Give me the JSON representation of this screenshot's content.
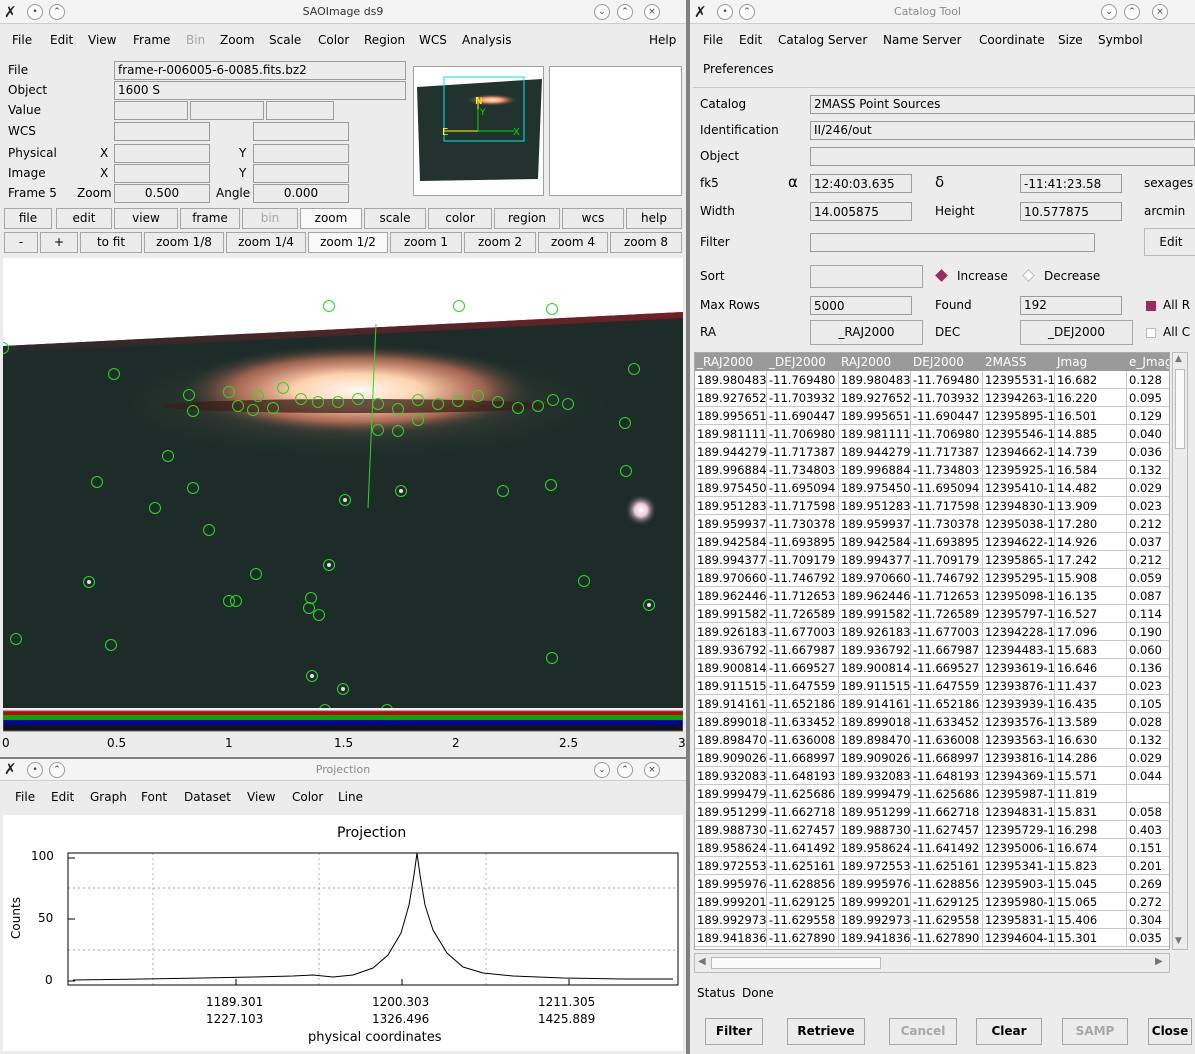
{
  "ds9": {
    "title": "SAOImage ds9",
    "menu": [
      "File",
      "Edit",
      "View",
      "Frame",
      "Bin",
      "Zoom",
      "Scale",
      "Color",
      "Region",
      "WCS",
      "Analysis"
    ],
    "help": "Help",
    "info": {
      "file_label": "File",
      "file_value": "frame-r-006005-6-0085.fits.bz2",
      "object_label": "Object",
      "object_value": "1600 S",
      "value_label": "Value",
      "wcs_label": "WCS",
      "physical_label": "Physical",
      "image_label": "Image",
      "x_label": "X",
      "y_label": "Y",
      "frame_label": "Frame 5",
      "zoom_label": "Zoom",
      "zoom_value": "0.500",
      "angle_label": "Angle",
      "angle_value": "0.000"
    },
    "panner_labels": {
      "n": "N",
      "e": "E",
      "x": "X",
      "y": "Y"
    },
    "buttonbar": [
      "file",
      "edit",
      "view",
      "frame",
      "bin",
      "zoom",
      "scale",
      "color",
      "region",
      "wcs",
      "help"
    ],
    "zoombar": [
      "-",
      "+",
      "to fit",
      "zoom 1/8",
      "zoom 1/4",
      "zoom 1/2",
      "zoom 1",
      "zoom 2",
      "zoom 4",
      "zoom 8"
    ],
    "colorbar_ticks": [
      "0",
      "0.5",
      "1",
      "1.5",
      "2",
      "2.5",
      "3"
    ]
  },
  "projection": {
    "title": "Projection",
    "menu": [
      "File",
      "Edit",
      "Graph",
      "Font",
      "Dataset",
      "View",
      "Color",
      "Line"
    ],
    "plot_title": "Projection",
    "ylabel": "Counts",
    "xlabel": "physical coordinates",
    "yticks": [
      "100",
      "50",
      "0"
    ],
    "xticks_top": [
      "1189.301",
      "1200.303",
      "1211.305"
    ],
    "xticks_bottom": [
      "1227.103",
      "1326.496",
      "1425.889"
    ]
  },
  "catalog": {
    "title": "Catalog Tool",
    "menu": [
      "File",
      "Edit",
      "Catalog Server",
      "Name Server",
      "Coordinate",
      "Size",
      "Symbol"
    ],
    "menu2": "Preferences",
    "catalog_label": "Catalog",
    "catalog_value": "2MASS Point Sources",
    "ident_label": "Identification",
    "ident_value": "II/246/out",
    "object_label": "Object",
    "object_value": "",
    "fk5_label": "fk5",
    "alpha": "α",
    "ra_value": "12:40:03.635",
    "delta": "δ",
    "dec_value": "-11:41:23.58",
    "sexages": "sexages",
    "width_label": "Width",
    "width_value": "14.005875",
    "height_label": "Height",
    "height_value": "10.577875",
    "arcmin": "arcmin",
    "filter_label": "Filter",
    "edit_btn": "Edit",
    "sort_label": "Sort",
    "increase": "Increase",
    "decrease": "Decrease",
    "maxrows_label": "Max Rows",
    "maxrows_value": "5000",
    "found_label": "Found",
    "found_value": "192",
    "all_r": "All R",
    "ra_label": "RA",
    "ra_btn": "_RAJ2000",
    "dec_label": "DEC",
    "dec_btn": "_DEJ2000",
    "all_c": "All C",
    "columns": [
      "_RAJ2000",
      "_DEJ2000",
      "RAJ2000",
      "DEJ2000",
      "2MASS",
      "Jmag",
      "e_Jmag"
    ],
    "rows": [
      [
        "189.980483",
        "-11.769480",
        "189.980483",
        "-11.769480",
        "12395531-1",
        "16.682",
        "0.128"
      ],
      [
        "189.927652",
        "-11.703932",
        "189.927652",
        "-11.703932",
        "12394263-1",
        "16.220",
        "0.095"
      ],
      [
        "189.995651",
        "-11.690447",
        "189.995651",
        "-11.690447",
        "12395895-1",
        "16.501",
        "0.129"
      ],
      [
        "189.981111",
        "-11.706980",
        "189.981111",
        "-11.706980",
        "12395546-1",
        "14.885",
        "0.040"
      ],
      [
        "189.944279",
        "-11.717387",
        "189.944279",
        "-11.717387",
        "12394662-1",
        "14.739",
        "0.036"
      ],
      [
        "189.996884",
        "-11.734803",
        "189.996884",
        "-11.734803",
        "12395925-1",
        "16.584",
        "0.132"
      ],
      [
        "189.975450",
        "-11.695094",
        "189.975450",
        "-11.695094",
        "12395410-1",
        "14.482",
        "0.029"
      ],
      [
        "189.951283",
        "-11.717598",
        "189.951283",
        "-11.717598",
        "12394830-1",
        "13.909",
        "0.023"
      ],
      [
        "189.959937",
        "-11.730378",
        "189.959937",
        "-11.730378",
        "12395038-1",
        "17.280",
        "0.212"
      ],
      [
        "189.942584",
        "-11.693895",
        "189.942584",
        "-11.693895",
        "12394622-1",
        "14.926",
        "0.037"
      ],
      [
        "189.994377",
        "-11.709179",
        "189.994377",
        "-11.709179",
        "12395865-1",
        "17.242",
        "0.212"
      ],
      [
        "189.970660",
        "-11.746792",
        "189.970660",
        "-11.746792",
        "12395295-1",
        "15.908",
        "0.059"
      ],
      [
        "189.962446",
        "-11.712653",
        "189.962446",
        "-11.712653",
        "12395098-1",
        "16.135",
        "0.087"
      ],
      [
        "189.991582",
        "-11.726589",
        "189.991582",
        "-11.726589",
        "12395797-1",
        "16.527",
        "0.114"
      ],
      [
        "189.926183",
        "-11.677003",
        "189.926183",
        "-11.677003",
        "12394228-1",
        "17.096",
        "0.190"
      ],
      [
        "189.936792",
        "-11.667987",
        "189.936792",
        "-11.667987",
        "12394483-1",
        "15.683",
        "0.060"
      ],
      [
        "189.900814",
        "-11.669527",
        "189.900814",
        "-11.669527",
        "12393619-1",
        "16.646",
        "0.136"
      ],
      [
        "189.911515",
        "-11.647559",
        "189.911515",
        "-11.647559",
        "12393876-1",
        "11.437",
        "0.023"
      ],
      [
        "189.914161",
        "-11.652186",
        "189.914161",
        "-11.652186",
        "12393939-1",
        "16.435",
        "0.105"
      ],
      [
        "189.899018",
        "-11.633452",
        "189.899018",
        "-11.633452",
        "12393576-1",
        "13.589",
        "0.028"
      ],
      [
        "189.898470",
        "-11.636008",
        "189.898470",
        "-11.636008",
        "12393563-1",
        "16.630",
        "0.132"
      ],
      [
        "189.909026",
        "-11.668997",
        "189.909026",
        "-11.668997",
        "12393816-1",
        "14.286",
        "0.029"
      ],
      [
        "189.932083",
        "-11.648193",
        "189.932083",
        "-11.648193",
        "12394369-1",
        "15.571",
        "0.044"
      ],
      [
        "189.999479",
        "-11.625686",
        "189.999479",
        "-11.625686",
        "12395987-1",
        "11.819",
        ""
      ],
      [
        "189.951299",
        "-11.662718",
        "189.951299",
        "-11.662718",
        "12394831-1",
        "15.831",
        "0.058"
      ],
      [
        "189.988730",
        "-11.627457",
        "189.988730",
        "-11.627457",
        "12395729-1",
        "16.298",
        "0.403"
      ],
      [
        "189.958624",
        "-11.641492",
        "189.958624",
        "-11.641492",
        "12395006-1",
        "16.674",
        "0.151"
      ],
      [
        "189.972553",
        "-11.625161",
        "189.972553",
        "-11.625161",
        "12395341-1",
        "15.823",
        "0.201"
      ],
      [
        "189.995976",
        "-11.628856",
        "189.995976",
        "-11.628856",
        "12395903-1",
        "15.045",
        "0.269"
      ],
      [
        "189.999201",
        "-11.629125",
        "189.999201",
        "-11.629125",
        "12395980-1",
        "15.065",
        "0.272"
      ],
      [
        "189.992973",
        "-11.629558",
        "189.992973",
        "-11.629558",
        "12395831-1",
        "15.406",
        "0.304"
      ],
      [
        "189.941836",
        "-11.627890",
        "189.941836",
        "-11.627890",
        "12394604-1",
        "15.301",
        "0.035"
      ]
    ],
    "status_label": "Status",
    "status_value": "Done",
    "bottom_buttons": [
      "Filter",
      "Retrieve",
      "Cancel",
      "Clear",
      "SAMP",
      "Close"
    ]
  },
  "colors": {
    "circle": "#22dd22",
    "accent": "#9b2d5e"
  }
}
